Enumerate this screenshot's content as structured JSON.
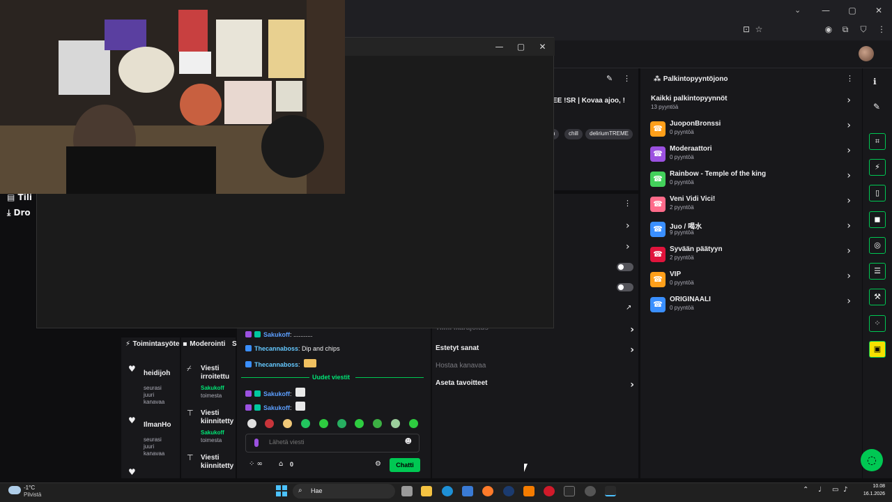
{
  "browser": {
    "tray_icons": [
      "install-icon",
      "star-icon",
      "account-icon",
      "extensions-icon",
      "shield-icon",
      "menu-icon"
    ]
  },
  "window_controls": {
    "minimize": "—",
    "maximize": "▢",
    "close": "✕"
  },
  "left_nav": {
    "item1": "Tili",
    "item2": "Dro"
  },
  "stream_info": {
    "title_fragment": "EE !SR | Kovaa ajoo, !",
    "tags": [
      "h",
      "chill",
      "deliriumTREME"
    ]
  },
  "settings_rows": {
    "tiimi": "Tiimi ikärajoitus",
    "estetyt": "Estetyt sanat",
    "hostaa": "Hostaa kanavaa",
    "tavoitteet": "Aseta tavoitteet"
  },
  "rewards": {
    "title": "Palkintopyyntöjono",
    "all_label": "Kaikki palkintopyynnöt",
    "all_count": "13 pyyntöä",
    "items": [
      {
        "name": "JuoponBronssi",
        "count": "0 pyyntöä",
        "color": "#ff9f1a"
      },
      {
        "name": "Moderaattori",
        "count": "0 pyyntöä",
        "color": "#9b51e0"
      },
      {
        "name": "Rainbow - Temple of the king",
        "count": "0 pyyntöä",
        "color": "#43d15b"
      },
      {
        "name": "Veni Vidi Vici!",
        "count": "2 pyyntöä",
        "color": "#ff6b8a"
      },
      {
        "name": "Juo / 喝水",
        "count": "9 pyyntöä",
        "color": "#3a8fff"
      },
      {
        "name": "Syvään päätyyn",
        "count": "2 pyyntöä",
        "color": "#e0143c"
      },
      {
        "name": "VIP",
        "count": "0 pyyntöä",
        "color": "#ff9f1a"
      },
      {
        "name": "ORIGINAALI",
        "count": "0 pyyntöä",
        "color": "#3a8fff"
      }
    ]
  },
  "activity": {
    "tab1": "Toimintasyöte",
    "tab2": "Moderointi",
    "tab3": "S",
    "follows": [
      {
        "name": "heidijoh",
        "sub": "seurasi juuri kanavaa"
      },
      {
        "name": "IlmanHo",
        "sub": "seurasi juuri kanavaa"
      }
    ],
    "mod": [
      {
        "head": "Viesti irroitettu",
        "user": "Sakukoff",
        "act": "toimesta"
      },
      {
        "head": "Viesti kiinnitetty",
        "user": "Sakukoff",
        "act": "toimesta"
      },
      {
        "head": "Viesti kiinnitetty"
      }
    ]
  },
  "chat": {
    "lines": [
      {
        "user": "Sakukoff",
        "text": ": ..........."
      },
      {
        "user": "Thecannaboss",
        "text": ": Dip and chips"
      },
      {
        "user": "Thecannaboss",
        "text": ":"
      },
      {
        "user": "Sakukoff",
        "text": ":"
      },
      {
        "user": "Sakukoff",
        "text": ":"
      }
    ],
    "new_messages": "Uudet viestit",
    "placeholder": "Lähetä viesti",
    "points": "0",
    "send": "Chatti"
  },
  "taskbar": {
    "weather_temp": "-1°C",
    "weather_text": "Pilvistä",
    "search": "Hae",
    "time": "10.08",
    "date": "16.1.2026"
  }
}
